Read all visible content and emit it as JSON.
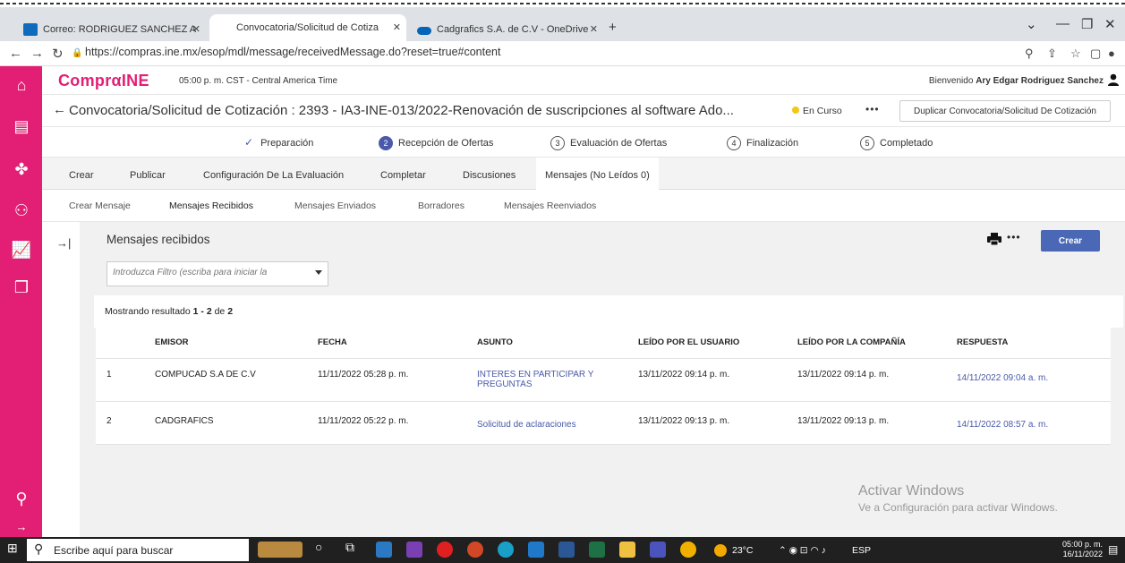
{
  "browser": {
    "tabs": [
      {
        "label": "Correo: RODRIGUEZ SANCHEZ A",
        "icon": "outlook-icon",
        "color": "#0f6cbd"
      },
      {
        "label": "Convocatoria/Solicitud de Cotiza",
        "icon": "ine-icon",
        "color": "#ffffff"
      },
      {
        "label": "Cadgrafics S.A. de C.V - OneDrive",
        "icon": "onedrive-icon",
        "color": "#0364b8"
      }
    ],
    "new_tab": "+",
    "url": "https://compras.ine.mx/esop/mdl/message/receivedMessage.do?reset=true#content"
  },
  "header": {
    "logo": "ComprαINE",
    "time": "05:00 p. m. CST - Central America Time",
    "welcome_prefix": "Bienvenido",
    "user": "Ary Edgar Rodriguez Sanchez"
  },
  "title_bar": {
    "title": "Convocatoria/Solicitud de Cotización : 2393 - IA3-INE-013/2022-Renovación de suscripciones al software Ado...",
    "status": "En Curso",
    "more": "•••",
    "duplicate_label": "Duplicar Convocatoria/Solicitud De Cotización"
  },
  "steps": [
    {
      "num": "",
      "label": "Preparación",
      "state": "done"
    },
    {
      "num": "2",
      "label": "Recepción de Ofertas",
      "state": "current"
    },
    {
      "num": "3",
      "label": "Evaluación de Ofertas",
      "state": "pending"
    },
    {
      "num": "4",
      "label": "Finalización",
      "state": "pending"
    },
    {
      "num": "5",
      "label": "Completado",
      "state": "pending"
    }
  ],
  "menu1": [
    "Crear",
    "Publicar",
    "Configuración De La Evaluación",
    "Completar",
    "Discusiones",
    "Mensajes (No Leídos 0)"
  ],
  "menu2": [
    "Crear Mensaje",
    "Mensajes Recibidos",
    "Mensajes Enviados",
    "Borradores",
    "Mensajes Reenviados"
  ],
  "section": {
    "title": "Mensajes recibidos",
    "more": "•••",
    "create_label": "Crear",
    "filter_placeholder": "Introduzca Filtro (escriba para iniciar la",
    "results_prefix": "Mostrando resultado",
    "results_range": "1 - 2",
    "results_mid": "de",
    "results_total": "2"
  },
  "table": {
    "headers": [
      "",
      "EMISOR",
      "FECHA",
      "ASUNTO",
      "LEÍDO POR EL USUARIO",
      "LEÍDO POR LA COMPAÑÍA",
      "RESPUESTA"
    ],
    "rows": [
      [
        "1",
        "COMPUCAD S.A DE C.V",
        "11/11/2022 05:28 p. m.",
        "INTERES EN PARTICIPAR Y PREGUNTAS",
        "13/11/2022 09:14 p. m.",
        "13/11/2022 09:14 p. m.",
        "14/11/2022 09:04 a. m."
      ],
      [
        "2",
        "CADGRAFICS",
        "11/11/2022 05:22 p. m.",
        "Solicitud de aclaraciones",
        "13/11/2022 09:13 p. m.",
        "13/11/2022 09:13 p. m.",
        "14/11/2022 08:57 a. m."
      ]
    ]
  },
  "watermark": {
    "line1": "Activar Windows",
    "line2": "Ve a Configuración para activar Windows."
  },
  "taskbar": {
    "search_placeholder": "Escribe aquí para buscar",
    "weather": "23°C",
    "lang": "ESP",
    "time": "05:00 p. m.",
    "date": "16/11/2022",
    "notif_count": "4"
  },
  "colors": {
    "brand": "#e21f74",
    "accent": "#4a68b5",
    "link": "#4a5aa8"
  }
}
